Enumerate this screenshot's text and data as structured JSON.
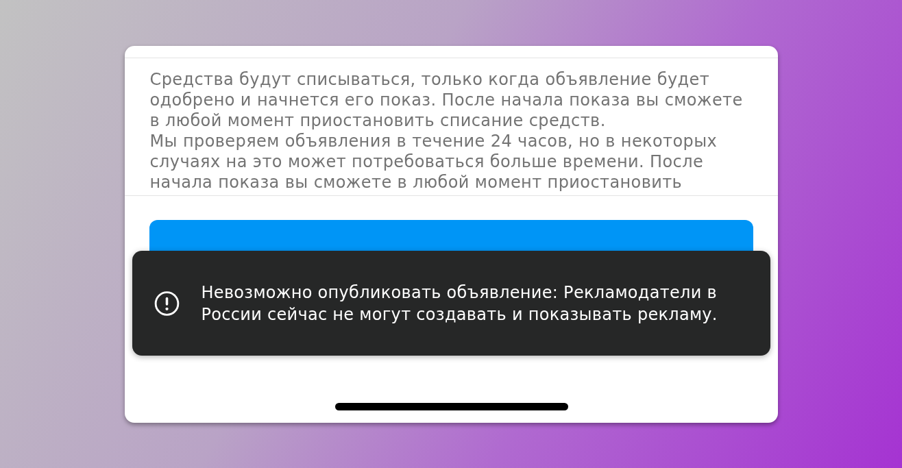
{
  "sheet": {
    "paragraphs": [
      "Средства будут списываться, только когда объявление будет одобрено и начнется его показ. После начала показа вы сможете в любой момент приостановить списание средств.",
      "Мы проверяем объявления в течение 24 часов, но в некоторых случаях на это может потребоваться больше времени. После начала показа вы сможете в любой момент приостановить"
    ]
  },
  "toast": {
    "message": "Невозможно опубликовать объявление: Рекламодатели в России сейчас не могут создавать и показывать рекламу."
  }
}
